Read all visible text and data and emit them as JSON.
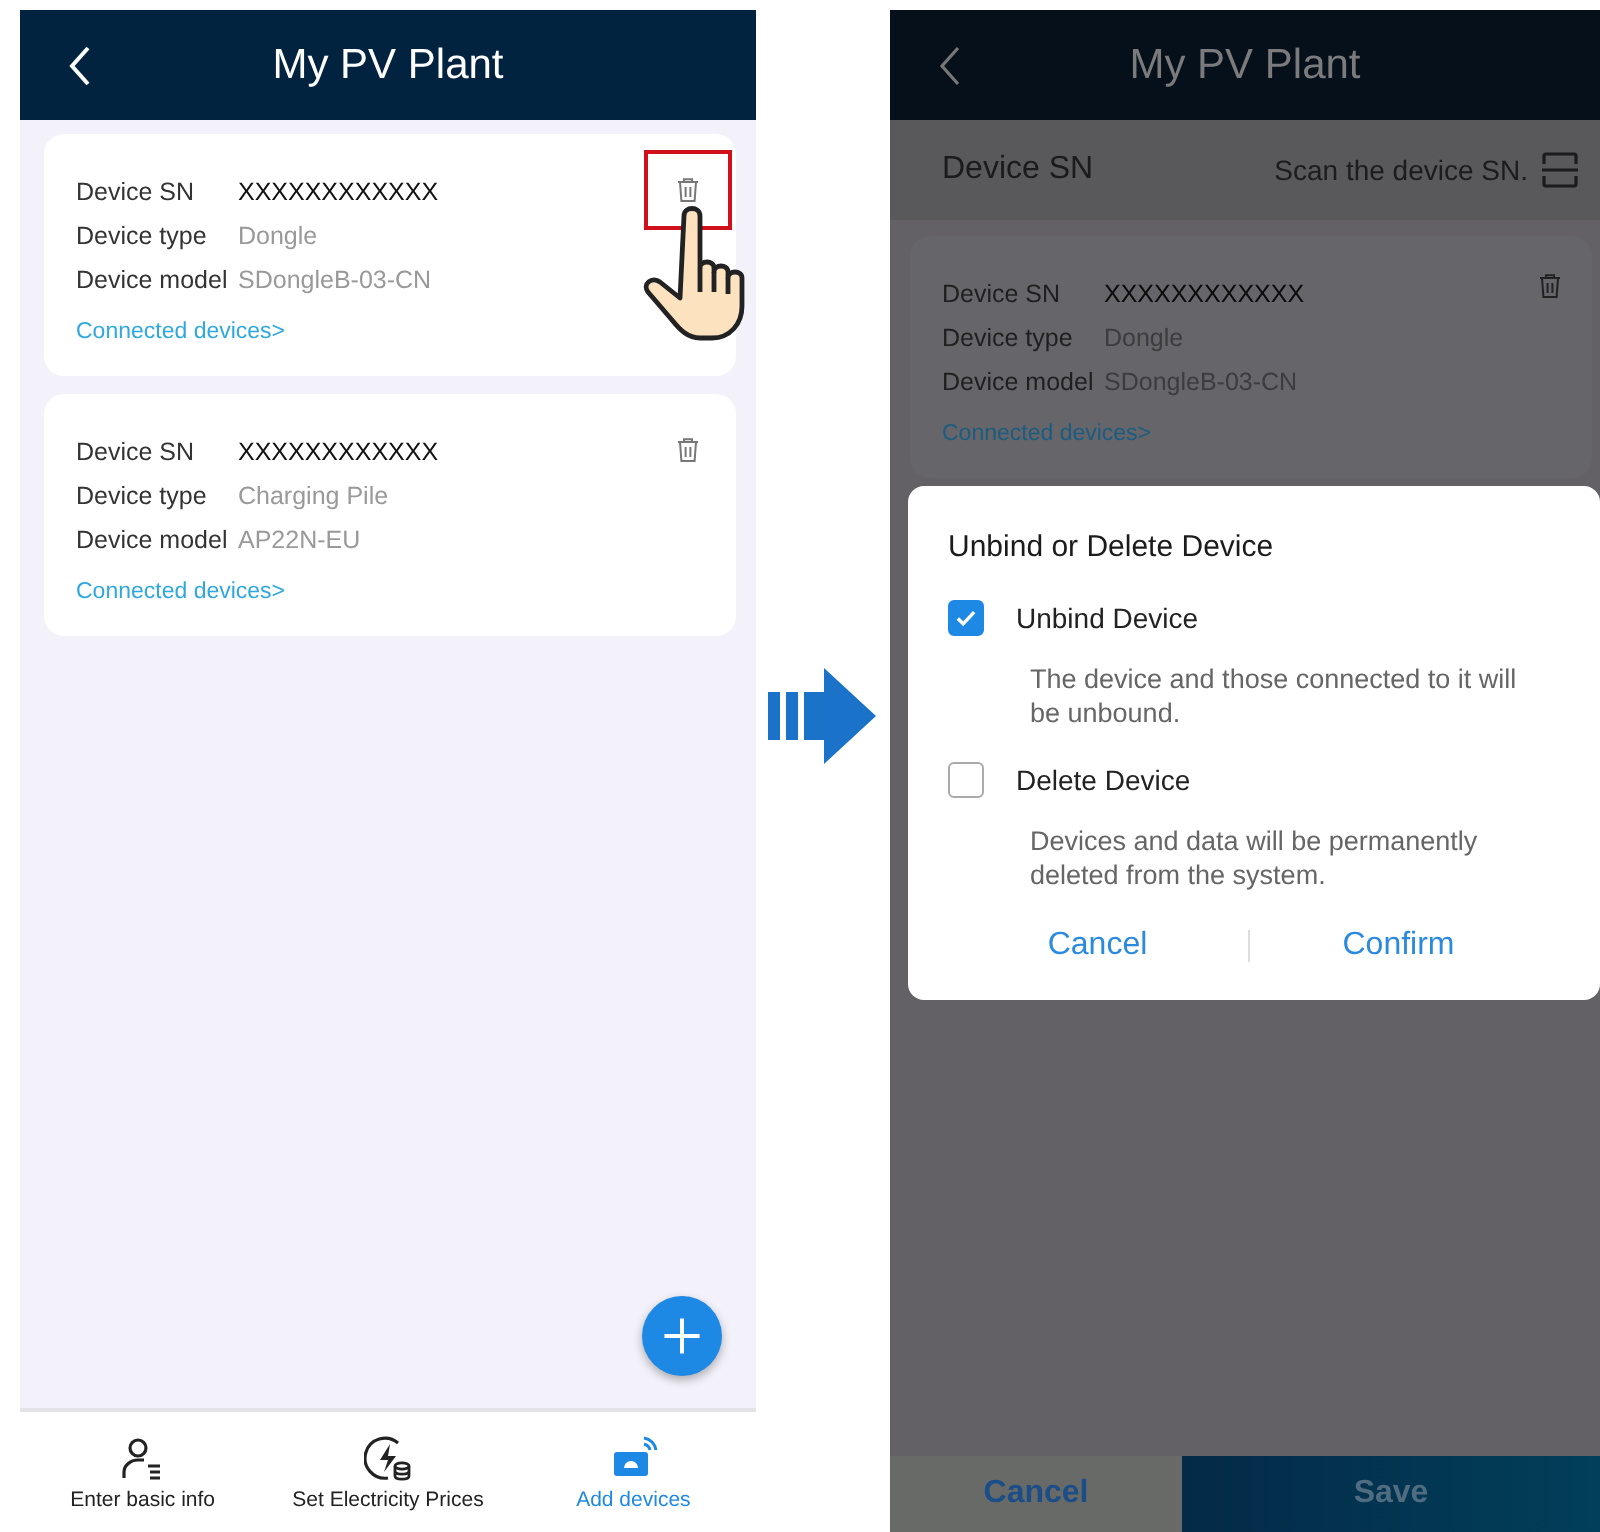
{
  "left_screen": {
    "header": {
      "title": "My PV Plant"
    },
    "devices": [
      {
        "sn_label": "Device SN",
        "sn": "XXXXXXXXXXXX",
        "type_label": "Device type",
        "type": "Dongle",
        "model_label": "Device model",
        "model": "SDongleB-03-CN",
        "link": "Connected devices>",
        "highlighted": true
      },
      {
        "sn_label": "Device SN",
        "sn": "XXXXXXXXXXXX",
        "type_label": "Device type",
        "type": "Charging Pile",
        "model_label": "Device model",
        "model": "AP22N-EU",
        "link": "Connected devices>",
        "highlighted": false
      }
    ],
    "nav": [
      {
        "kind": "person",
        "label": "Enter basic info",
        "selected": false
      },
      {
        "kind": "price",
        "label": "Set Electricity Prices",
        "selected": false
      },
      {
        "kind": "device",
        "label": "Add devices",
        "selected": true
      }
    ]
  },
  "right_screen": {
    "header": {
      "title": "My PV Plant"
    },
    "sn_field": {
      "label": "Device SN",
      "placeholder": "Scan the device SN."
    },
    "device": {
      "sn_label": "Device SN",
      "sn": "XXXXXXXXXXXX",
      "type_label": "Device type",
      "type": "Dongle",
      "model_label": "Device model",
      "model": "SDongleB-03-CN",
      "link": "Connected devices>"
    },
    "dialog": {
      "title": "Unbind or Delete Device",
      "options": [
        {
          "label": "Unbind Device",
          "description": "The device and those connected to it will be unbound.",
          "checked": true
        },
        {
          "label": "Delete Device",
          "description": "Devices and data will be permanently deleted from the system.",
          "checked": false
        }
      ],
      "buttons": [
        "Cancel",
        "Confirm"
      ]
    },
    "footer": {
      "cancel": "Cancel",
      "save": "Save"
    }
  }
}
